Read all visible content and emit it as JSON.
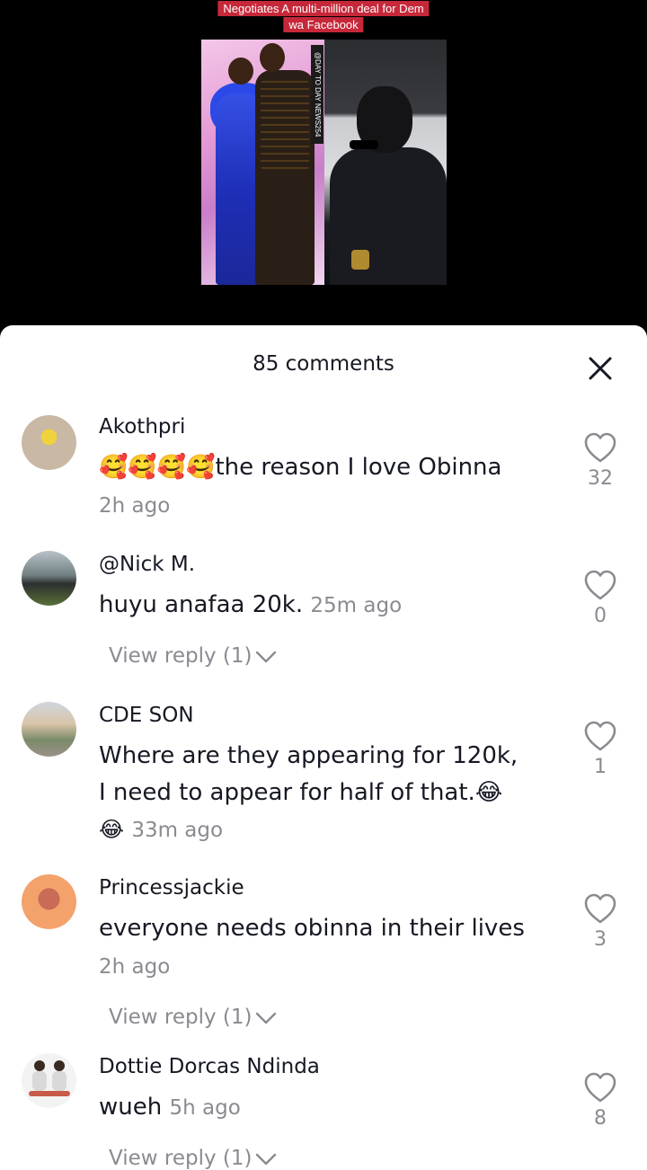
{
  "video": {
    "caption_line1": "Negotiates A multi-million deal for Dem",
    "caption_line2": "wa Facebook",
    "watermark": "@DAY TO DAY NEWS254"
  },
  "sheet": {
    "title": "85 comments",
    "close_icon": "close-icon"
  },
  "comments": [
    {
      "username": "Akothpri",
      "text": "🥰🥰🥰🥰the reason I love Obinna",
      "time": "2h ago",
      "likes": "32"
    },
    {
      "username": "@Nick M.",
      "text": "huyu anafaa 20k.",
      "time": "25m ago",
      "likes": "0",
      "view_reply": "View reply (1)"
    },
    {
      "username": "CDE SON",
      "text_line1": "Where are they appearing for 120k,",
      "text_line2": "I need to appear for half of that.😂",
      "text_line3_emoji": "😂",
      "time": "33m ago",
      "likes": "1"
    },
    {
      "username": "Princessjackie",
      "text": "everyone needs obinna in their lives",
      "time": "2h ago",
      "likes": "3",
      "view_reply": "View reply (1)"
    },
    {
      "username": "Dottie Dorcas Ndinda",
      "text": "wueh",
      "time": "5h ago",
      "likes": "8",
      "view_reply": "View reply (1)"
    }
  ]
}
